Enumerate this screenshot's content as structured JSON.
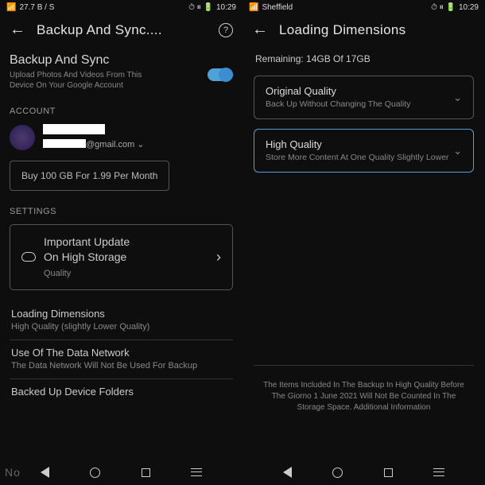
{
  "screen1": {
    "status": {
      "left": "27.7 B / S",
      "time": "10:29"
    },
    "header": {
      "title": "Backup And Sync...."
    },
    "backup": {
      "title": "Backup And Sync",
      "sub1": "Upload Photos And Videos From This",
      "sub2": "Device On Your Google Account"
    },
    "account_label": "ACCOUNT",
    "email_suffix": "@gmail.com",
    "buy_btn": "Buy 100 GB For 1.99 Per Month",
    "settings_label": "SETTINGS",
    "card": {
      "line1": "Important Update",
      "line2": "On High Storage",
      "sub": "Quality"
    },
    "loading": {
      "title": "Loading Dimensions",
      "sub": "High Quality (slightly Lower Quality)"
    },
    "network": {
      "title": "Use Of The Data Network",
      "sub": "The Data Network Will Not Be Used For Backup"
    },
    "folders": "Backed Up Device Folders",
    "no": "No"
  },
  "screen2": {
    "status": {
      "left": "Sheffield",
      "time": "10:29"
    },
    "header": {
      "title": "Loading Dimensions"
    },
    "remaining": "Remaining: 14GB Of 17GB",
    "opt1": {
      "title": "Original Quality",
      "sub": "Back Up Without Changing The Quality"
    },
    "opt2": {
      "title": "High Quality",
      "sub": "Store More Content At One Quality Slightly Lower"
    },
    "footnote": "The Items Included In The Backup In High Quality Before The Giorno 1 June 2021 Will Not Be Counted In The Storage Space. Additional Information"
  }
}
